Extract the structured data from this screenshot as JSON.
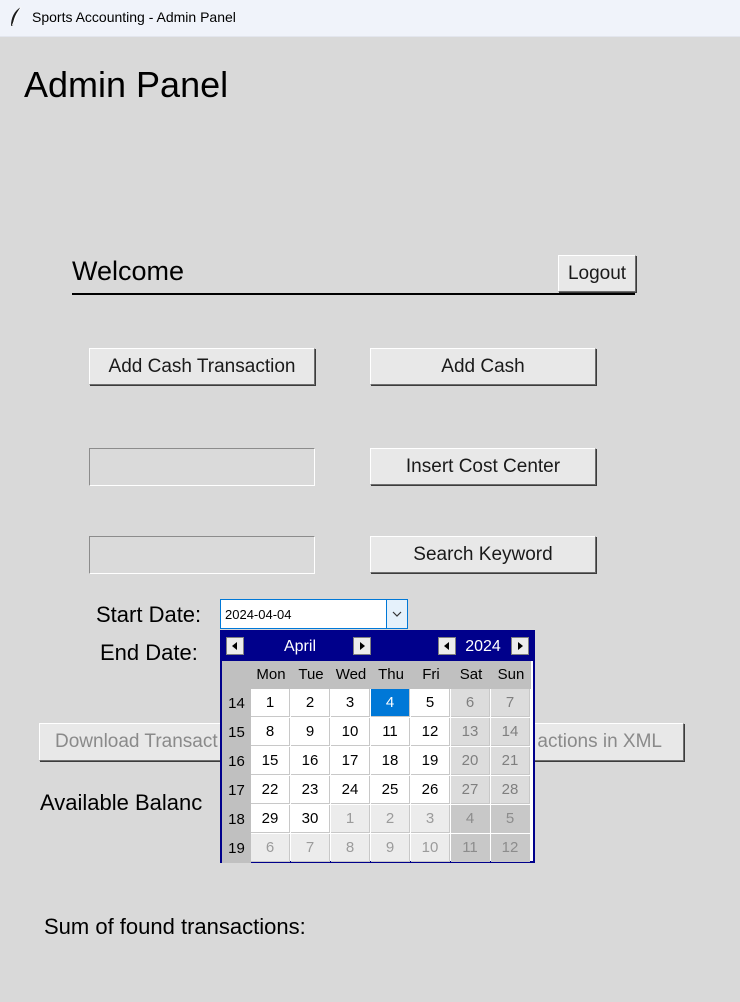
{
  "window": {
    "title": "Sports Accounting - Admin Panel",
    "icon": "feather-icon"
  },
  "page": {
    "heading": "Admin Panel",
    "welcome": "Welcome",
    "logout_label": "Logout",
    "add_cash_transaction_label": "Add Cash Transaction",
    "add_cash_label": "Add Cash",
    "cost_center_input_value": "",
    "insert_cost_center_label": "Insert Cost Center",
    "keyword_input_value": "",
    "search_keyword_label": "Search Keyword",
    "start_date_label": "Start Date:",
    "end_date_label": "End Date:",
    "start_date_value": "2024-04-04",
    "download_button_label": "Download Transact",
    "xml_button_label": "actions in XML",
    "available_balance_label": "Available Balanc",
    "sum_label": "Sum of found transactions:"
  },
  "calendar": {
    "month": "April",
    "year": "2024",
    "weekdays": [
      "Mon",
      "Tue",
      "Wed",
      "Thu",
      "Fri",
      "Sat",
      "Sun"
    ],
    "selected_date": "4",
    "weeks": [
      {
        "num": "14",
        "days": [
          "1",
          "2",
          "3",
          "4",
          "5",
          "6",
          "7"
        ]
      },
      {
        "num": "15",
        "days": [
          "8",
          "9",
          "10",
          "11",
          "12",
          "13",
          "14"
        ]
      },
      {
        "num": "16",
        "days": [
          "15",
          "16",
          "17",
          "18",
          "19",
          "20",
          "21"
        ]
      },
      {
        "num": "17",
        "days": [
          "22",
          "23",
          "24",
          "25",
          "26",
          "27",
          "28"
        ]
      },
      {
        "num": "18",
        "days": [
          "29",
          "30",
          "1",
          "2",
          "3",
          "4",
          "5"
        ]
      },
      {
        "num": "19",
        "days": [
          "6",
          "7",
          "8",
          "9",
          "10",
          "11",
          "12"
        ]
      }
    ]
  },
  "colors": {
    "selected_day": "#0078d7",
    "calendar_header": "#00008b",
    "window_bg": "#d9d9d9"
  }
}
